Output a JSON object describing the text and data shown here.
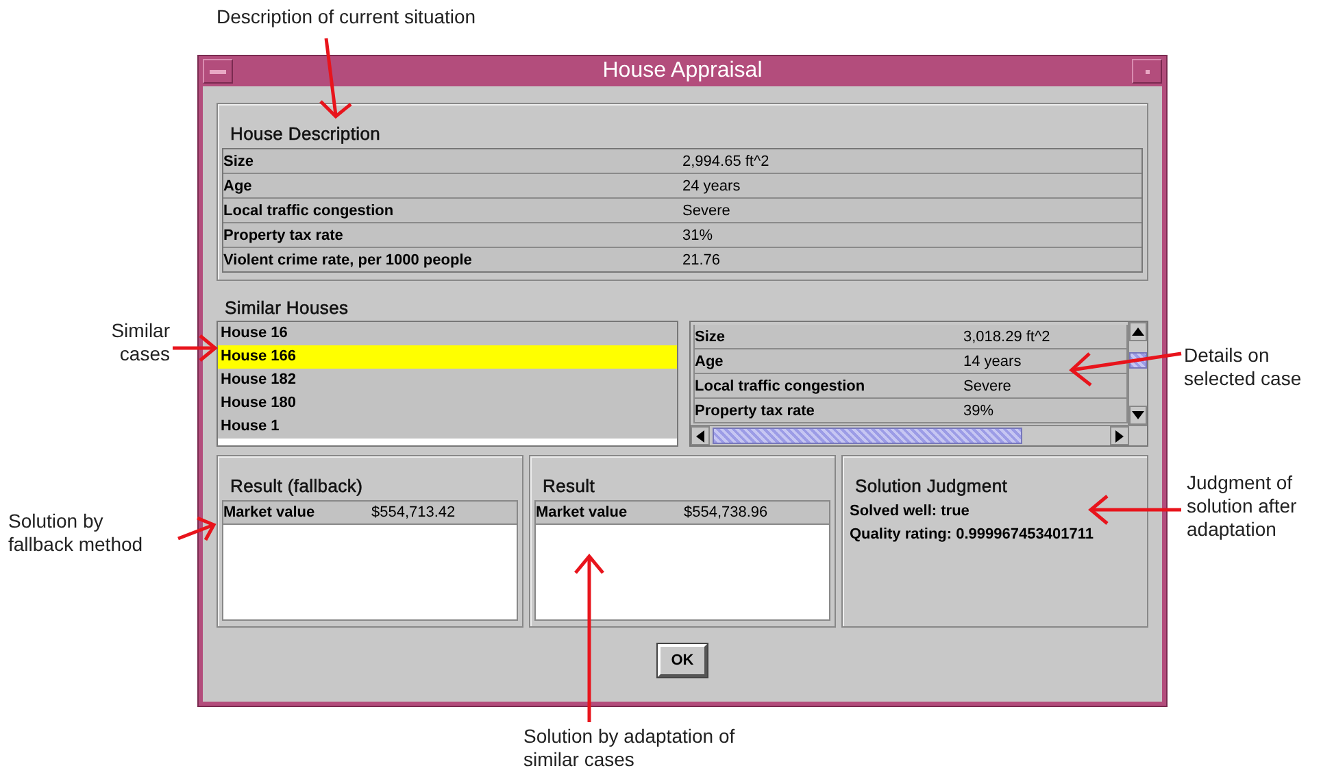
{
  "window": {
    "title": "House Appraisal"
  },
  "house_description": {
    "heading": "House Description",
    "rows": [
      {
        "label": "Size",
        "value": "2,994.65 ft^2"
      },
      {
        "label": "Age",
        "value": "24 years"
      },
      {
        "label": "Local traffic congestion",
        "value": "Severe"
      },
      {
        "label": "Property tax rate",
        "value": "31%"
      },
      {
        "label": "Violent crime rate, per 1000 people",
        "value": "21.76"
      }
    ]
  },
  "similar_houses": {
    "heading": "Similar Houses",
    "items": [
      {
        "label": "House 16",
        "selected": false
      },
      {
        "label": "House 166",
        "selected": true
      },
      {
        "label": "House 182",
        "selected": false
      },
      {
        "label": "House 180",
        "selected": false
      },
      {
        "label": "House 1",
        "selected": false
      }
    ],
    "details": [
      {
        "label": "Size",
        "value": "3,018.29 ft^2"
      },
      {
        "label": "Age",
        "value": "14 years"
      },
      {
        "label": "Local traffic congestion",
        "value": "Severe"
      },
      {
        "label": "Property tax rate",
        "value": "39%"
      }
    ]
  },
  "result_fallback": {
    "heading": "Result (fallback)",
    "label": "Market value",
    "value": "$554,713.42"
  },
  "result": {
    "heading": "Result",
    "label": "Market value",
    "value": "$554,738.96"
  },
  "solution_judgment": {
    "heading": "Solution Judgment",
    "lines": [
      "Solved well: true",
      "Quality rating: 0.999967453401711"
    ]
  },
  "buttons": [
    "OK"
  ],
  "annotations": [
    {
      "text": "Description of current situation"
    },
    {
      "text": "Similar cases"
    },
    {
      "text": "Solution by fallback method"
    },
    {
      "text": "Details on selected case"
    },
    {
      "text": "Judgment of solution after adaptation"
    },
    {
      "text": "Solution by adaptation of similar cases"
    }
  ]
}
